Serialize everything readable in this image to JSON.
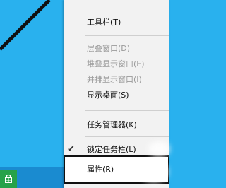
{
  "context_menu": {
    "items": [
      {
        "label": "工具栏(T)",
        "enabled": true
      },
      {
        "label": "层叠窗口(D)",
        "enabled": false
      },
      {
        "label": "堆叠显示窗口(E)",
        "enabled": false
      },
      {
        "label": "并排显示窗口(I)",
        "enabled": false
      },
      {
        "label": "显示桌面(S)",
        "enabled": true
      },
      {
        "label": "任务管理器(K)",
        "enabled": true
      },
      {
        "label": "锁定任务栏(L)",
        "enabled": true,
        "checked": true
      },
      {
        "label": "属性(R)",
        "enabled": true,
        "highlighted": true
      }
    ],
    "check_mark": "✔"
  },
  "colors": {
    "desktop": "#29b1ee",
    "menu_background": "#f2f2f2",
    "disabled_text": "#9a9a9a",
    "store_tile": "#27a24a"
  },
  "icons": [
    "store-icon",
    "check-icon"
  ]
}
